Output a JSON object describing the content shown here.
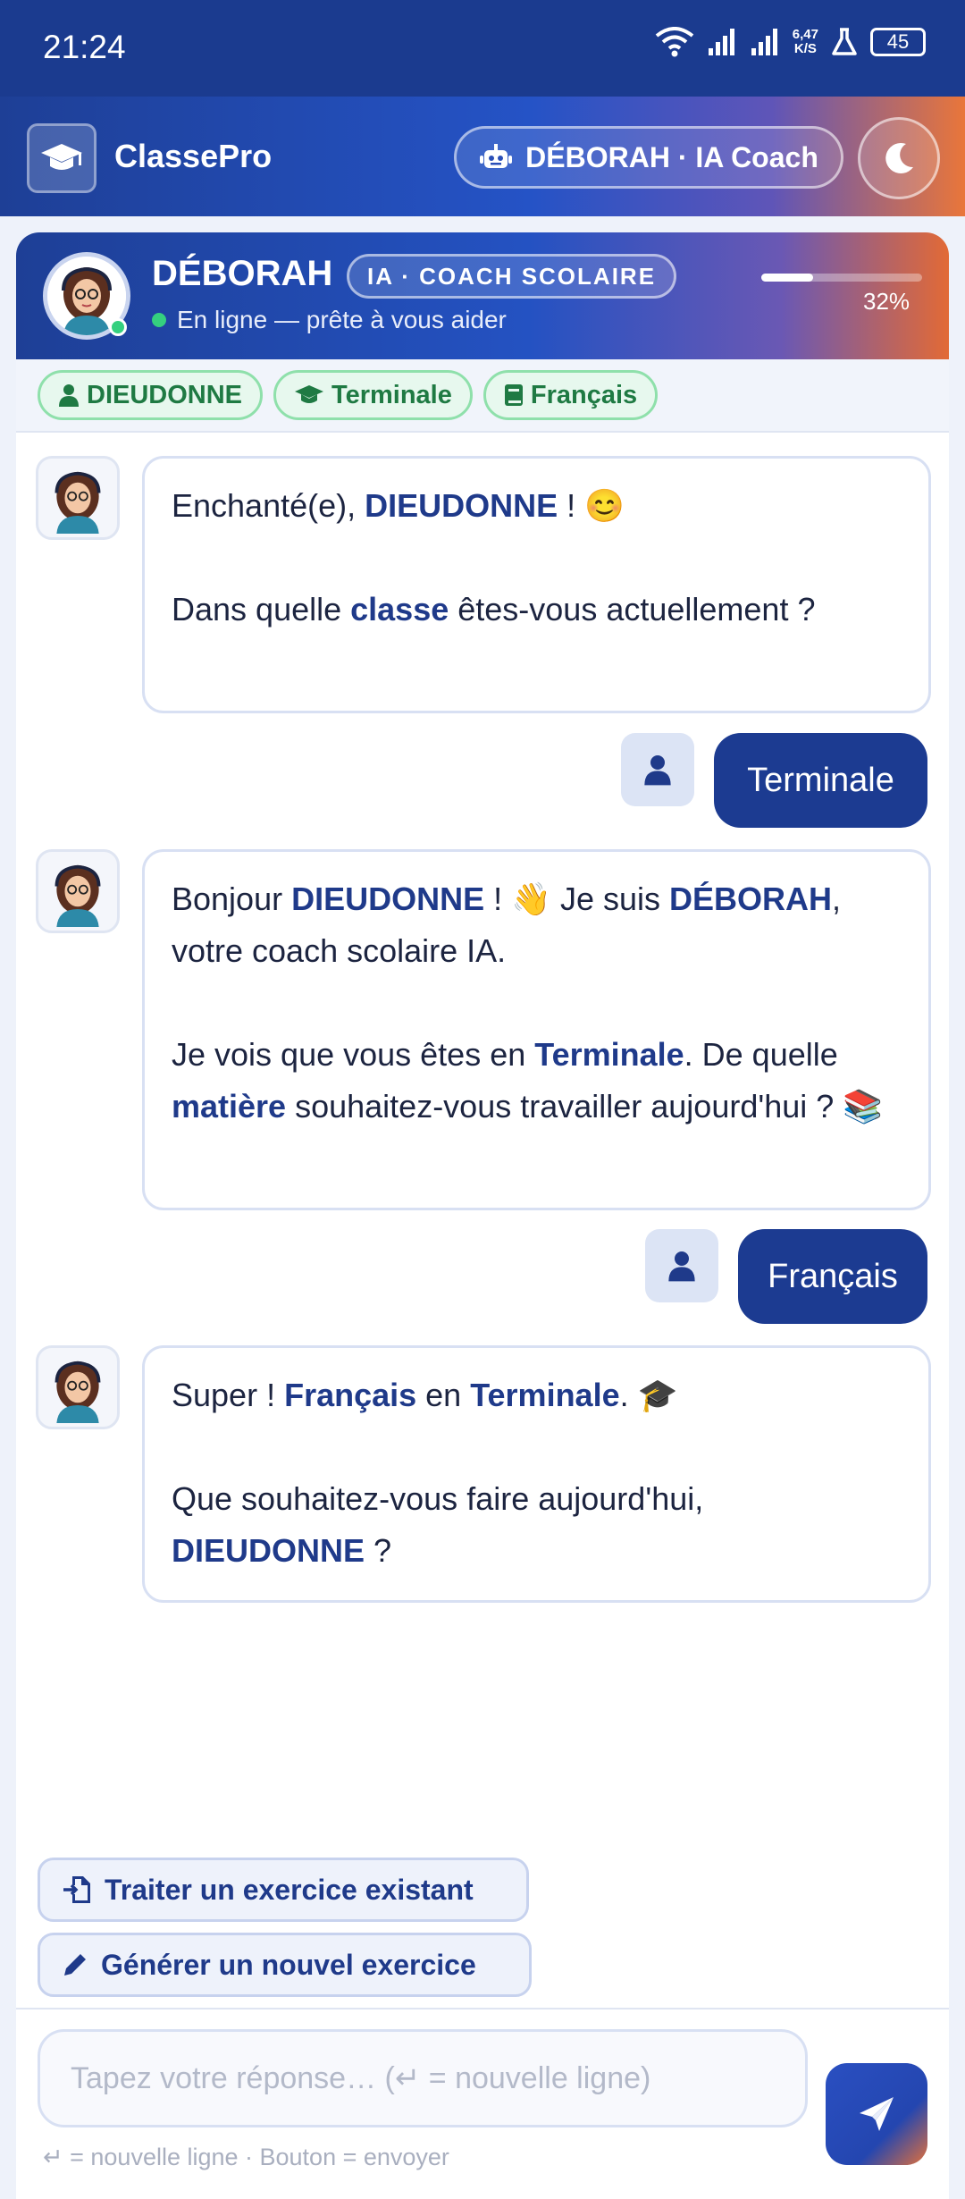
{
  "status_bar": {
    "time": "21:24",
    "speed_value": "6,47",
    "speed_unit": "K/S",
    "battery": "45"
  },
  "app": {
    "title": "ClassePro",
    "coach_pill_label": "DÉBORAH · IA Coach"
  },
  "coach": {
    "name": "DÉBORAH",
    "badge": "IA · COACH SCOLAIRE",
    "status": "En ligne — prête à vous aider",
    "progress_label": "32%",
    "progress_fraction": 0.32
  },
  "tags": [
    {
      "label": "DIEUDONNE",
      "icon": "user-icon"
    },
    {
      "label": "Terminale",
      "icon": "graduation-cap-icon"
    },
    {
      "label": "Français",
      "icon": "book-icon"
    }
  ],
  "messages": {
    "bot1": {
      "l1a": "Enchanté(e), ",
      "l1b": "DIEUDONNE",
      "l1c": " ! 😊",
      "l2a": "Dans quelle ",
      "l2b": "classe",
      "l2c": " êtes-vous actuellement ?"
    },
    "user1": "Terminale",
    "bot2": {
      "a": "Bonjour ",
      "b": "DIEUDONNE",
      "c": " ! 👋 Je suis ",
      "d": "DÉBORAH",
      "e": ", votre coach scolaire IA.",
      "f": "Je vois que vous êtes en ",
      "g": "Terminale",
      "h": ". De quelle ",
      "i": "matière",
      "j": " souhaitez-vous travailler aujourd'hui ? 📚"
    },
    "user2": "Français",
    "bot3": {
      "a": "Super ! ",
      "b": "Français",
      "c": " en ",
      "d": "Terminale",
      "e": ". 🎓",
      "f": "Que souhaitez-vous faire aujourd'hui, ",
      "g": "DIEUDONNE",
      "h": " ?"
    }
  },
  "actions": {
    "existing": "Traiter un exercice existant",
    "generate": "Générer un nouvel exercice"
  },
  "input": {
    "placeholder": "Tapez votre réponse… (↵ = nouvelle ligne)",
    "hint": "↵ = nouvelle ligne  ·  Bouton = envoyer"
  }
}
